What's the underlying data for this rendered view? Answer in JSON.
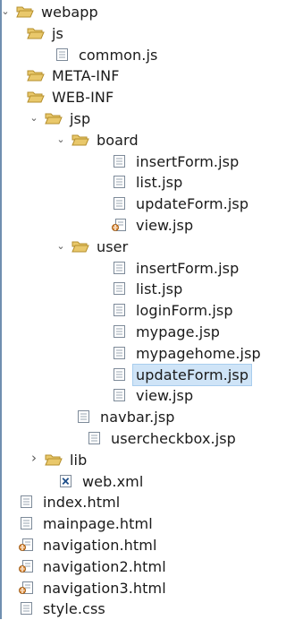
{
  "tree": {
    "items": [
      {
        "label": "webapp",
        "icon": "folder-open-icon",
        "twisty": "expanded",
        "level": 0
      },
      {
        "label": "js",
        "icon": "folder-open-icon",
        "twisty": "none",
        "level": 1
      },
      {
        "label": "common.js",
        "icon": "file-icon",
        "twisty": "none",
        "level": 2
      },
      {
        "label": "META-INF",
        "icon": "folder-open-icon",
        "twisty": "none",
        "level": 1
      },
      {
        "label": "WEB-INF",
        "icon": "folder-open-icon",
        "twisty": "none",
        "level": 1
      },
      {
        "label": "jsp",
        "icon": "folder-open-icon",
        "twisty": "expanded",
        "level": 1
      },
      {
        "label": "board",
        "icon": "folder-open-icon",
        "twisty": "expanded",
        "level": 2
      },
      {
        "label": "insertForm.jsp",
        "icon": "file-icon",
        "twisty": "none",
        "level": 3
      },
      {
        "label": "list.jsp",
        "icon": "file-icon",
        "twisty": "none",
        "level": 3
      },
      {
        "label": "updateForm.jsp",
        "icon": "file-icon",
        "twisty": "none",
        "level": 3
      },
      {
        "label": "view.jsp",
        "icon": "web-file-icon",
        "twisty": "none",
        "level": 3
      },
      {
        "label": "user",
        "icon": "folder-open-icon",
        "twisty": "expanded",
        "level": 2
      },
      {
        "label": "insertForm.jsp",
        "icon": "file-icon",
        "twisty": "none",
        "level": 3
      },
      {
        "label": "list.jsp",
        "icon": "file-icon",
        "twisty": "none",
        "level": 3
      },
      {
        "label": "loginForm.jsp",
        "icon": "file-icon",
        "twisty": "none",
        "level": 3
      },
      {
        "label": "mypage.jsp",
        "icon": "file-icon",
        "twisty": "none",
        "level": 3
      },
      {
        "label": "mypagehome.jsp",
        "icon": "file-icon",
        "twisty": "none",
        "level": 3
      },
      {
        "label": "updateForm.jsp",
        "icon": "file-icon",
        "twisty": "none",
        "level": 3,
        "selected": true
      },
      {
        "label": "view.jsp",
        "icon": "file-icon",
        "twisty": "none",
        "level": 3
      },
      {
        "label": "navbar.jsp",
        "icon": "file-icon",
        "twisty": "none",
        "level": 2
      },
      {
        "label": "usercheckbox.jsp",
        "icon": "file-icon",
        "twisty": "none",
        "level": 2
      },
      {
        "label": "lib",
        "icon": "folder-open-icon",
        "twisty": "collapsed",
        "level": 1
      },
      {
        "label": "web.xml",
        "icon": "xml-file-icon",
        "twisty": "none",
        "level": 1
      },
      {
        "label": "index.html",
        "icon": "file-icon",
        "twisty": "none",
        "level": 0
      },
      {
        "label": "mainpage.html",
        "icon": "file-icon",
        "twisty": "none",
        "level": 0
      },
      {
        "label": "navigation.html",
        "icon": "web-file-icon",
        "twisty": "none",
        "level": 0
      },
      {
        "label": "navigation2.html",
        "icon": "web-file-icon",
        "twisty": "none",
        "level": 0
      },
      {
        "label": "navigation3.html",
        "icon": "web-file-icon",
        "twisty": "none",
        "level": 0
      },
      {
        "label": "style.css",
        "icon": "file-icon",
        "twisty": "none",
        "level": 0
      }
    ]
  },
  "colors": {
    "folder": "#e9c86b",
    "folder_edge": "#b58f2c",
    "file_edge": "#7d8a99",
    "selection": "#cfe4f7",
    "xml_badge": "#1f4f8a"
  }
}
